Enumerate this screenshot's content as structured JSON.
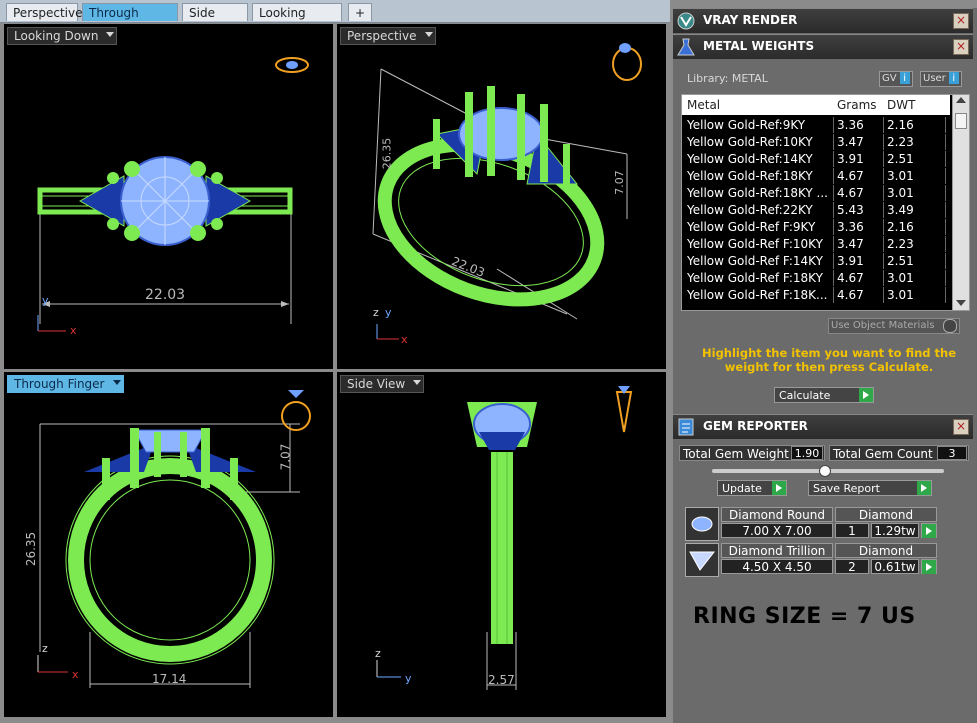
{
  "tabs": [
    "Perspective",
    "Through Finger",
    "Side View",
    "Looking Down"
  ],
  "tab_add": "+",
  "viewports": {
    "looking_down": {
      "label": "Looking Down",
      "dimension": "22.03"
    },
    "perspective": {
      "label": "Perspective",
      "dim_height": "26.35",
      "dim_width": "22.03",
      "dim_side": "7.07"
    },
    "through_finger": {
      "label": "Through Finger",
      "dim_height": "26.35",
      "dim_top": "7.07",
      "dim_width": "17.14"
    },
    "side_view": {
      "label": "Side View",
      "dimension": "2.57"
    }
  },
  "axes": {
    "x": "x",
    "y": "y",
    "z": "z"
  },
  "panel": {
    "vray": {
      "title": "VRAY RENDER",
      "close": "×"
    },
    "metal": {
      "title": "METAL WEIGHTS",
      "close": "×",
      "library": "Library: METAL",
      "gv": "GV",
      "user": "User",
      "columns": [
        "Metal",
        "Grams",
        "DWT"
      ],
      "rows": [
        [
          "Yellow Gold-Ref:9KY",
          "3.36",
          "2.16"
        ],
        [
          "Yellow Gold-Ref:10KY",
          "3.47",
          "2.23"
        ],
        [
          "Yellow Gold-Ref:14KY",
          "3.91",
          "2.51"
        ],
        [
          "Yellow Gold-Ref:18KY",
          "4.67",
          "3.01"
        ],
        [
          "Yellow Gold-Ref:18KY ...",
          "4.67",
          "3.01"
        ],
        [
          "Yellow Gold-Ref:22KY",
          "5.43",
          "3.49"
        ],
        [
          "Yellow Gold-Ref F:9KY",
          "3.36",
          "2.16"
        ],
        [
          "Yellow Gold-Ref F:10KY",
          "3.47",
          "2.23"
        ],
        [
          "Yellow Gold-Ref F:14KY",
          "3.91",
          "2.51"
        ],
        [
          "Yellow Gold-Ref F:18KY",
          "4.67",
          "3.01"
        ],
        [
          "Yellow Gold-Ref F:18K...",
          "4.67",
          "3.01"
        ]
      ],
      "use_object_materials": "Use Object Materials",
      "hint": "Highlight the item you want to find the weight for then press Calculate.",
      "calculate": "Calculate"
    },
    "gem": {
      "title": "GEM REPORTER",
      "close": "×",
      "total_weight_label": "Total Gem Weight",
      "total_weight": "1.90",
      "total_count_label": "Total Gem Count",
      "total_count": "3",
      "update": "Update",
      "save_report": "Save Report",
      "gems": [
        {
          "shape": "Diamond Round",
          "size": "7.00 X 7.00",
          "type": "Diamond",
          "count": "1",
          "weight": "1.29tw"
        },
        {
          "shape": "Diamond Trillion",
          "size": "4.50 X 4.50",
          "type": "Diamond",
          "count": "2",
          "weight": "0.61tw"
        }
      ]
    },
    "ring_size": "RING SIZE = 7 US"
  },
  "colors": {
    "metal_green": "#7dea52",
    "gem_blue": "#1a3aa8",
    "diamond_light": "#8fb4ff",
    "gold_icon": "#f0a020",
    "tab_active": "#5fb7e6",
    "hint": "#f2c200"
  }
}
